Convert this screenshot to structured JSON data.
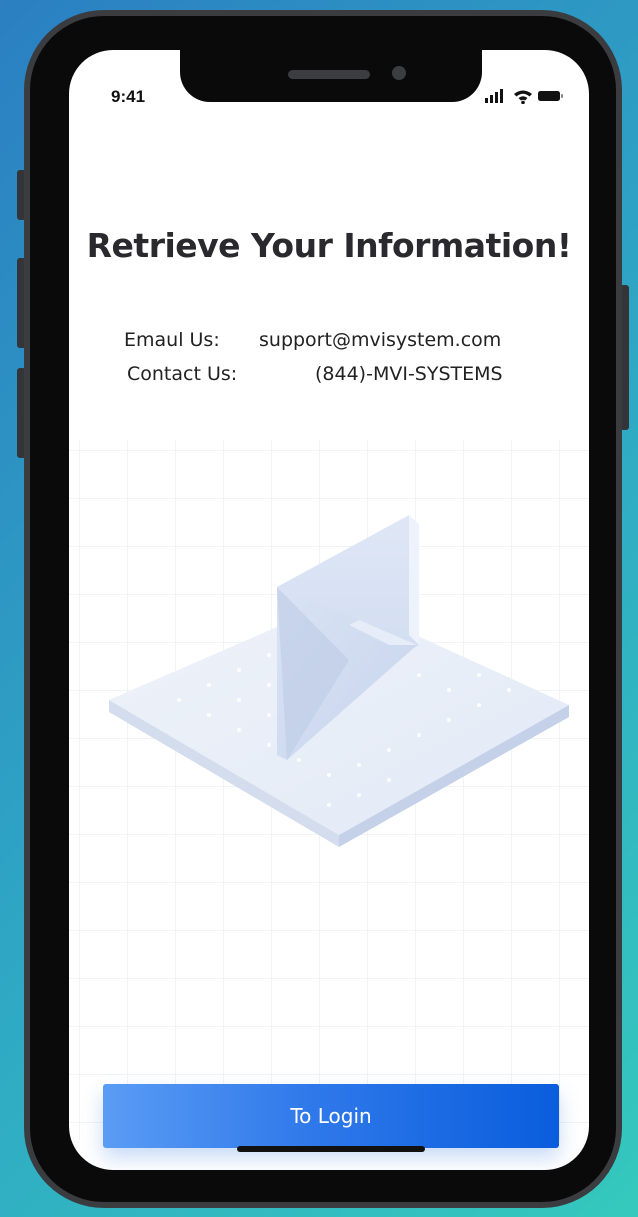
{
  "status_bar": {
    "time": "9:41",
    "icons": [
      "cellular-signal-icon",
      "wifi-icon",
      "battery-icon"
    ]
  },
  "page": {
    "title": "Retrieve Your Information!"
  },
  "contact": {
    "email_label": "Emaul Us:",
    "email_value": "support@mvisystem.com",
    "phone_label": "Contact Us:",
    "phone_value": "(844)-MVI-SYSTEMS"
  },
  "actions": {
    "login_label": "To Login"
  },
  "colors": {
    "background_start": "#2b7fc2",
    "background_end": "#35c9bd",
    "button_start": "#5a9cf5",
    "button_end": "#0a5ddd",
    "envelope_accent": "#1d5fe0"
  }
}
